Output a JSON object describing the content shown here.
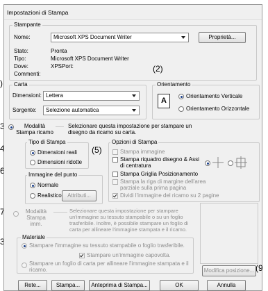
{
  "dialog": {
    "title": "Impostazioni di Stampa"
  },
  "printer": {
    "legend": "Stampante",
    "name_label": "Nome:",
    "name_value": "Microsoft XPS Document Writer",
    "properties_button": "Proprietà...",
    "status_label": "Stato:",
    "status_value": "Pronta",
    "type_label": "Tipo:",
    "type_value": "Microsoft XPS Document Writer",
    "where_label": "Dove:",
    "where_value": "XPSPort:",
    "comment_label": "Commenti:",
    "comment_value": ""
  },
  "paper": {
    "legend": "Carta",
    "size_label": "Dimensioni:",
    "size_value": "Lettera",
    "source_label": "Sorgente:",
    "source_value": "Selezione automatica"
  },
  "orientation": {
    "legend": "Orientamento",
    "portrait": "Orientamento Verticale",
    "landscape": "Orientamento Orizzontale",
    "selected": "portrait"
  },
  "callouts": {
    "c2": "(2)",
    "c5": "(5)",
    "c9": "(9",
    "left": [
      ")",
      "3)",
      "4)",
      "6)",
      "7)",
      "3)"
    ]
  },
  "sketch_mode": {
    "label": "Modalità Stampa ricamo",
    "description": "Selezionare questa impostazione per stampare un disegno da ricamo su carta.",
    "type_legend": "Tipo di Stampa",
    "real_size": "Dimensioni reali",
    "reduced_size": "Dimensioni ridotte",
    "point_legend": "Immagine del punto",
    "normal": "Normale",
    "realistic": "Realistico",
    "attributes_button": "Attributi..."
  },
  "print_options": {
    "legend": "Opzioni di Stampa",
    "items": [
      {
        "label": "Stampa immagine",
        "checked": false,
        "enabled": false
      },
      {
        "label": "Stampa riquadro disegno & Assi di centratura",
        "checked": false,
        "enabled": true
      },
      {
        "label": "Stampa Griglia Posizionamento",
        "checked": false,
        "enabled": true
      },
      {
        "label": "Stampa la riga di margine dell'area parziale sulla prima pagina",
        "checked": false,
        "enabled": false
      },
      {
        "label": "Dividi l'immagine del ricamo su 2 pagine",
        "checked": true,
        "enabled": false
      }
    ]
  },
  "image_mode": {
    "label": "Modalità Stampa imm.",
    "description": "Selezionare questa impostazione per stampare un'immagine su tessuto stampabile o su un foglio trasferibile. Inoltre, è possibile stampare un foglio di carta per allineare l'immagine stampata e il ricamo.",
    "material_legend": "Materiale",
    "fabric": "Stampare l'immagine su tessuto stampabile o foglio trasferibile.",
    "mirror": "Stampare un'immagine capovolta.",
    "align": "Stampare un foglio di carta per allineare l'immagine stampata e il ricamo.",
    "modify_button": "Modifica posizione..."
  },
  "footer": {
    "network": "Rete...",
    "print": "Stampa...",
    "preview": "Anteprima di Stampa...",
    "ok": "OK",
    "cancel": "Annulla"
  }
}
